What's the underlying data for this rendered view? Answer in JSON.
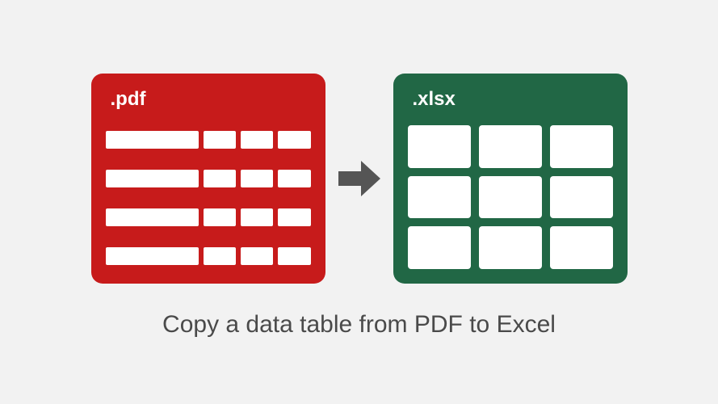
{
  "diagram": {
    "pdf_label": ".pdf",
    "xlsx_label": ".xlsx",
    "caption": "Copy a data table from PDF to Excel",
    "colors": {
      "pdf": "#c71b1b",
      "xlsx": "#216745",
      "arrow": "#555555",
      "background": "#f2f2f2",
      "caption": "#4a4a4a"
    },
    "pdf_table": {
      "rows": 4,
      "columns": 4
    },
    "xlsx_table": {
      "rows": 3,
      "columns": 3
    },
    "icons": {
      "arrow": "arrow-right-icon"
    }
  }
}
